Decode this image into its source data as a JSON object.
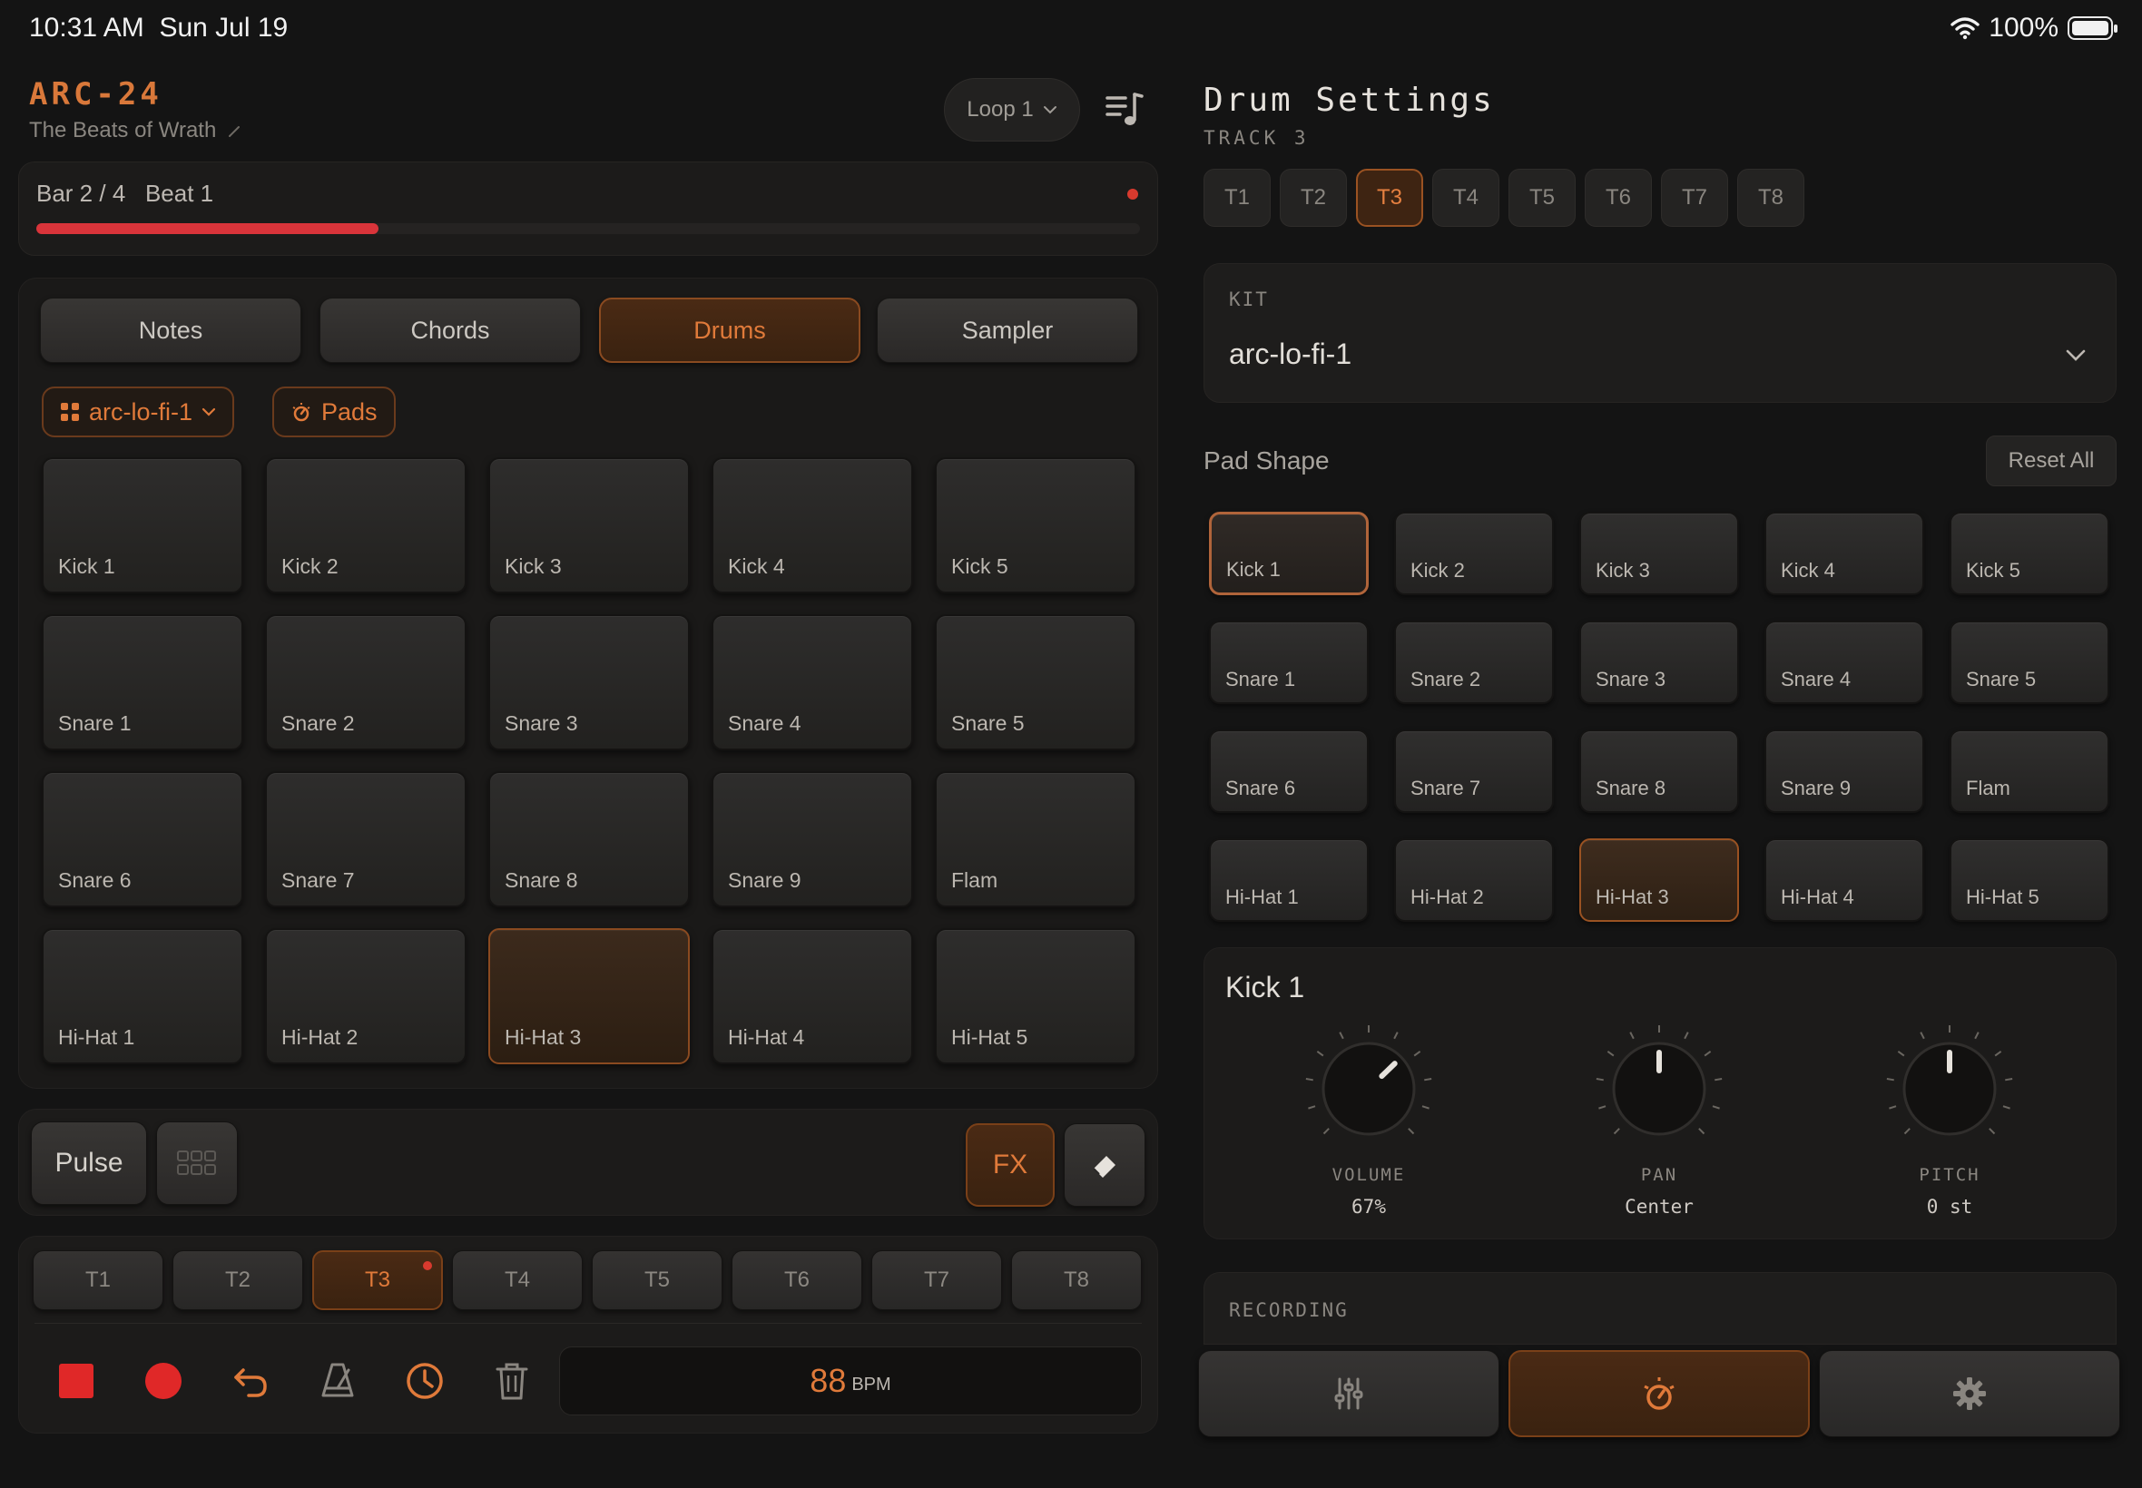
{
  "status_bar": {
    "time": "10:31 AM",
    "date": "Sun Jul 19",
    "battery": "100%"
  },
  "header": {
    "title": "ARC-24",
    "subtitle": "The Beats of Wrath",
    "loop_label": "Loop 1"
  },
  "progress": {
    "text": "Bar 2 / 4   Beat 1",
    "bar": 2,
    "bars_total": 4,
    "beat": 1,
    "fraction": 0.31
  },
  "mode_tabs": [
    {
      "label": "Notes"
    },
    {
      "label": "Chords"
    },
    {
      "label": "Drums",
      "active": true
    },
    {
      "label": "Sampler"
    }
  ],
  "kit_chip": {
    "label": "arc-lo-fi-1"
  },
  "pads_chip": {
    "label": "Pads"
  },
  "pads": [
    "Kick 1",
    "Kick 2",
    "Kick 3",
    "Kick 4",
    "Kick 5",
    "Snare 1",
    "Snare 2",
    "Snare 3",
    "Snare 4",
    "Snare 5",
    "Snare 6",
    "Snare 7",
    "Snare 8",
    "Snare 9",
    "Flam",
    "Hi-Hat 1",
    "Hi-Hat 2",
    "Hi-Hat 3",
    "Hi-Hat 4",
    "Hi-Hat 5"
  ],
  "active_pad": "Hi-Hat 3",
  "tools": {
    "pulse_label": "Pulse",
    "fx_label": "FX"
  },
  "track_tabs": [
    "T1",
    "T2",
    "T3",
    "T4",
    "T5",
    "T6",
    "T7",
    "T8"
  ],
  "active_track": "T3",
  "bpm": {
    "value": "88",
    "unit": "BPM"
  },
  "drum_settings": {
    "title": "Drum Settings",
    "subtitle": "TRACK 3",
    "track_tabs": [
      "T1",
      "T2",
      "T3",
      "T4",
      "T5",
      "T6",
      "T7",
      "T8"
    ],
    "kit_label": "KIT",
    "kit_value": "arc-lo-fi-1",
    "pad_shape_label": "Pad Shape",
    "reset_label": "Reset All",
    "selected_pad": "Kick 1",
    "knob_title": "Kick 1",
    "knobs": [
      {
        "label": "VOLUME",
        "value": "67%",
        "level": 0.67
      },
      {
        "label": "PAN",
        "value": "Center",
        "level": 0.5
      },
      {
        "label": "PITCH",
        "value": "0 st",
        "level": 0.5
      }
    ],
    "recording_label": "RECORDING"
  },
  "colors": {
    "accent": "#e07a3a",
    "record": "#d83a2e",
    "progress": "#d9343a",
    "background": "#141414"
  }
}
